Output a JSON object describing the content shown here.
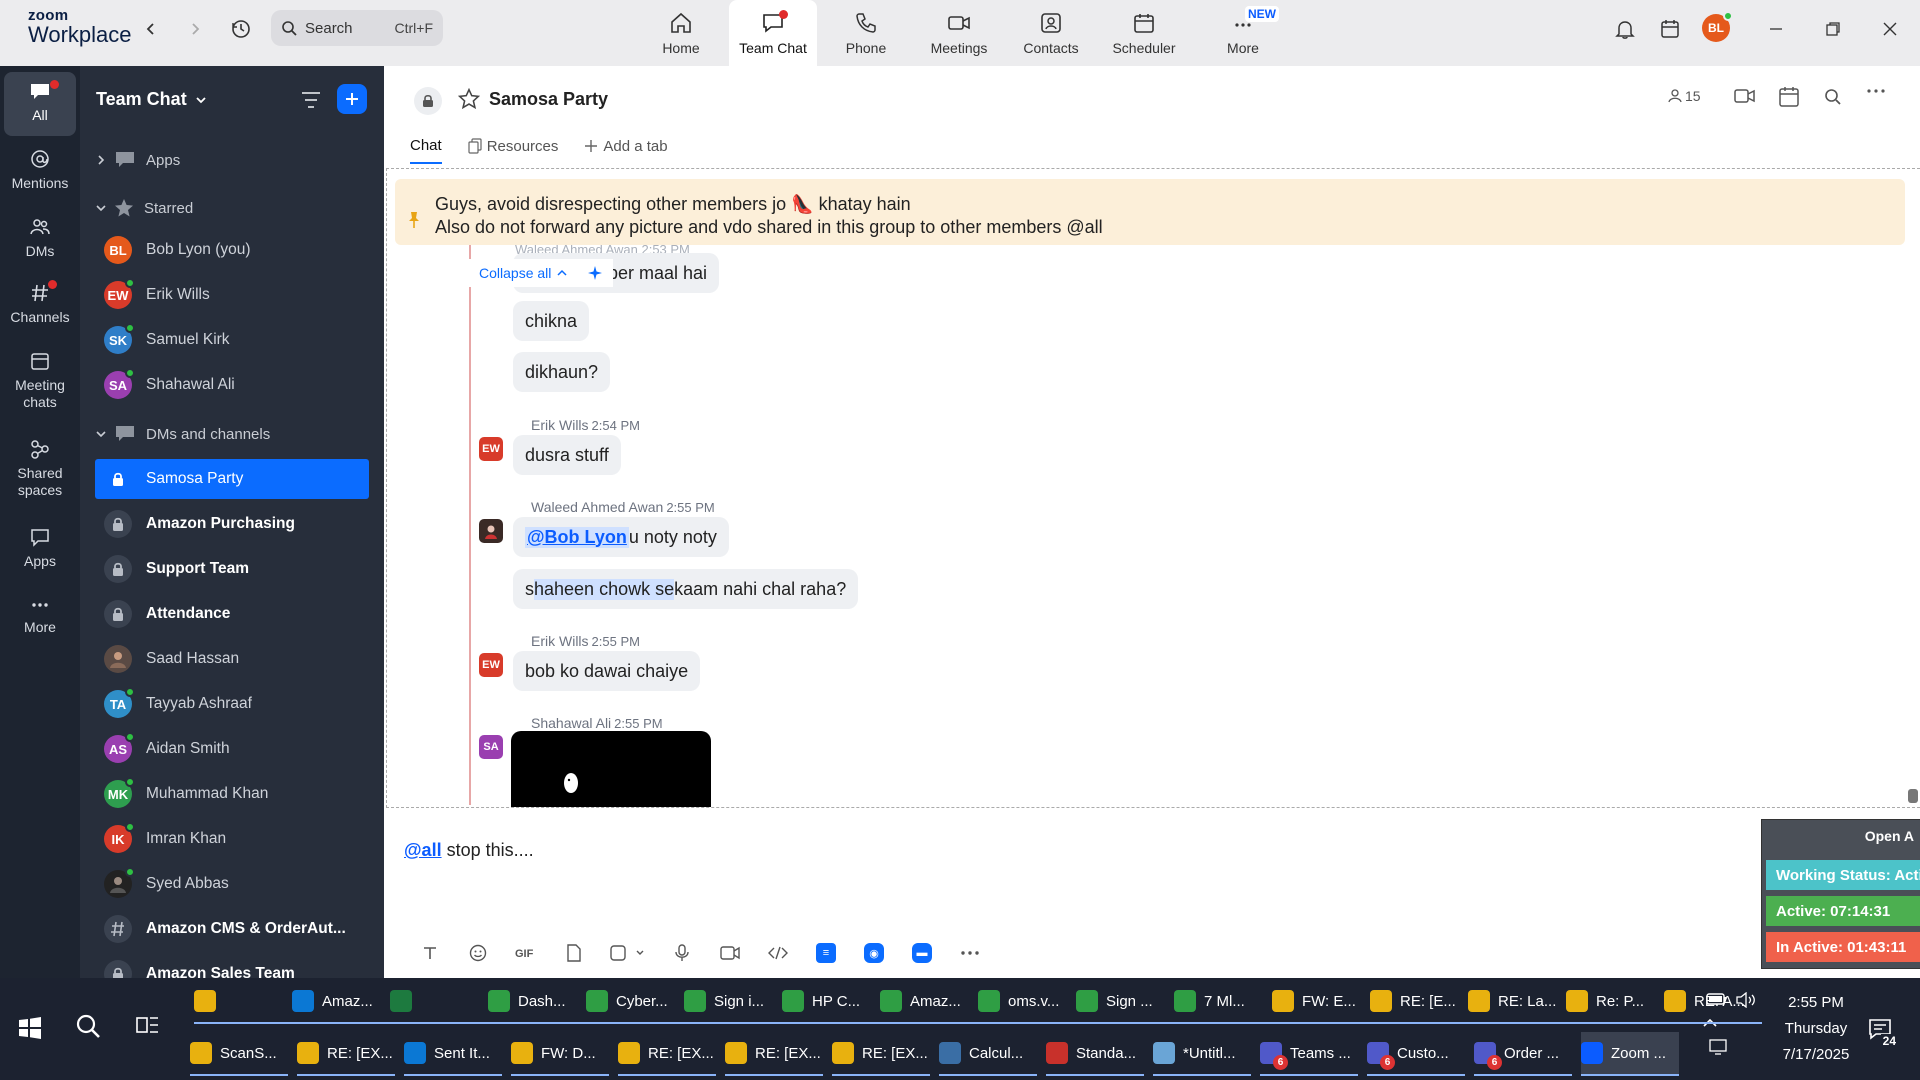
{
  "app": {
    "logo_line1": "zoom",
    "logo_line2": "Workplace",
    "search_placeholder": "Search",
    "search_shortcut": "Ctrl+F",
    "user_initials": "BL"
  },
  "nav": [
    {
      "label": "Home",
      "icon": "home-icon"
    },
    {
      "label": "Team Chat",
      "icon": "chat-icon",
      "active": true
    },
    {
      "label": "Phone",
      "icon": "phone-icon"
    },
    {
      "label": "Meetings",
      "icon": "video-icon"
    },
    {
      "label": "Contacts",
      "icon": "contacts-icon"
    },
    {
      "label": "Scheduler",
      "icon": "calendar-icon"
    },
    {
      "label": "More",
      "icon": "more-icon",
      "badge": "NEW"
    }
  ],
  "rail": [
    {
      "label": "All",
      "active": true
    },
    {
      "label": "Mentions"
    },
    {
      "label": "DMs"
    },
    {
      "label": "Channels"
    },
    {
      "label": "Meeting chats"
    },
    {
      "label": "Shared spaces"
    },
    {
      "label": "Apps"
    },
    {
      "label": "More"
    }
  ],
  "sidebar": {
    "title": "Team Chat",
    "groups": {
      "apps": "Apps",
      "starred": "Starred",
      "dms": "DMs and channels"
    },
    "starred": [
      {
        "initials": "BL",
        "name": "Bob Lyon (you)",
        "color": "#e5591b"
      },
      {
        "initials": "EW",
        "name": "Erik Wills",
        "color": "#d83b2a"
      },
      {
        "initials": "SK",
        "name": "Samuel Kirk",
        "color": "#2f7ec8"
      },
      {
        "initials": "SA",
        "name": "Shahawal Ali",
        "color": "#9a3fb0"
      }
    ],
    "channels": [
      {
        "type": "channel",
        "name": "Samosa Party",
        "active": true
      },
      {
        "type": "channel",
        "name": "Amazon Purchasing",
        "bold": true
      },
      {
        "type": "channel",
        "name": "Support Team",
        "bold": true
      },
      {
        "type": "channel",
        "name": "Attendance",
        "bold": true
      },
      {
        "type": "person",
        "initials": "",
        "name": "Saad Hassan",
        "color": "#3b3b3b",
        "photo": true
      },
      {
        "type": "person",
        "initials": "TA",
        "name": "Tayyab Ashraaf",
        "color": "#2f8fc8"
      },
      {
        "type": "person",
        "initials": "AS",
        "name": "Aidan Smith",
        "color": "#9a3fb0"
      },
      {
        "type": "person",
        "initials": "MK",
        "name": "Muhammad Khan",
        "color": "#2e9e4f"
      },
      {
        "type": "person",
        "initials": "IK",
        "name": "Imran Khan",
        "color": "#d83b2a"
      },
      {
        "type": "person",
        "initials": "",
        "name": "Syed Abbas",
        "color": "#222",
        "photo": true
      },
      {
        "type": "hash",
        "name": "Amazon CMS & OrderAut...",
        "bold": true
      },
      {
        "type": "channel",
        "name": "Amazon Sales Team",
        "bold": true
      }
    ]
  },
  "channel": {
    "title": "Samosa Party",
    "member_count": "15",
    "tabs": [
      "Chat",
      "Resources",
      "Add a tab"
    ]
  },
  "pinned": {
    "line1": "Guys, avoid disrespecting other members jo 👠 khatay hain",
    "line2": "Also do not forward any picture and vdo shared in this group to other members @all"
  },
  "thread": {
    "collapse_label": "Collapse all",
    "partial_header": "Waleed Ahmed Awan 2:53 PM"
  },
  "messages": [
    {
      "text": "lumber maal hai"
    },
    {
      "text": "chikna"
    },
    {
      "text": "dikhaun?"
    },
    {
      "sender": "Erik Wills",
      "time": "2:54 PM",
      "avatar": "EW",
      "text": "dusra stuff"
    },
    {
      "sender": "Waleed Ahmed Awan",
      "time": "2:55 PM",
      "mention": "@Bob Lyon",
      "text": " u noty noty"
    },
    {
      "text_pre": "s",
      "text_sel": "haheen chowk se",
      "text_post": " kaam nahi chal raha?"
    },
    {
      "sender": "Erik Wills",
      "time": "2:55 PM",
      "avatar": "EW",
      "text": "bob ko dawai chaiye"
    },
    {
      "sender": "Shahawal Ali",
      "time": "2:55 PM",
      "avatar": "SA"
    }
  ],
  "composer": {
    "mention": "@all",
    "text": "stop this...."
  },
  "widget": {
    "open_label": "Open A",
    "status": "Working Status: Acti",
    "active": "Active: 07:14:31",
    "inactive": "In Active: 01:43:11"
  },
  "taskbar": {
    "row1": [
      {
        "label": "",
        "color": "#e8b10f"
      },
      {
        "label": "Amaz...",
        "color": "#0b78d4"
      },
      {
        "label": "",
        "color": "#1d7a3f"
      },
      {
        "label": "Dash...",
        "color": "#2f9e44"
      },
      {
        "label": "Cyber...",
        "color": "#2f9e44"
      },
      {
        "label": "Sign i...",
        "color": "#2f9e44"
      },
      {
        "label": "HP C...",
        "color": "#2f9e44"
      },
      {
        "label": "Amaz...",
        "color": "#2f9e44"
      },
      {
        "label": "oms.v...",
        "color": "#2f9e44"
      },
      {
        "label": "Sign ...",
        "color": "#2f9e44"
      },
      {
        "label": "7 Ml...",
        "color": "#2f9e44"
      },
      {
        "label": "FW: E...",
        "color": "#e8b10f"
      },
      {
        "label": "RE: [E...",
        "color": "#e8b10f"
      },
      {
        "label": "RE: La...",
        "color": "#e8b10f"
      },
      {
        "label": "Re: P...",
        "color": "#e8b10f"
      },
      {
        "label": "RE: A...",
        "color": "#e8b10f"
      }
    ],
    "row2": [
      {
        "label": "ScanS...",
        "color": "#e8b10f"
      },
      {
        "label": "RE: [EX...",
        "color": "#e8b10f"
      },
      {
        "label": "Sent It...",
        "color": "#0b78d4"
      },
      {
        "label": "FW: D...",
        "color": "#e8b10f"
      },
      {
        "label": "RE: [EX...",
        "color": "#e8b10f"
      },
      {
        "label": "RE: [EX...",
        "color": "#e8b10f"
      },
      {
        "label": "RE: [EX...",
        "color": "#e8b10f"
      },
      {
        "label": "Calcul...",
        "color": "#3a6ea5"
      },
      {
        "label": "Standa...",
        "color": "#c8312b"
      },
      {
        "label": "*Untitl...",
        "color": "#6aa5d6"
      },
      {
        "label": "Teams ...",
        "color": "#5059c9",
        "badge": "6"
      },
      {
        "label": "Custo...",
        "color": "#5059c9",
        "badge": "6"
      },
      {
        "label": "Order ...",
        "color": "#5059c9",
        "badge": "6"
      },
      {
        "label": "Zoom ...",
        "color": "#0b5cff",
        "active": true
      }
    ],
    "time": "2:55 PM",
    "day": "Thursday",
    "date": "7/17/2025",
    "notifications": "24"
  }
}
